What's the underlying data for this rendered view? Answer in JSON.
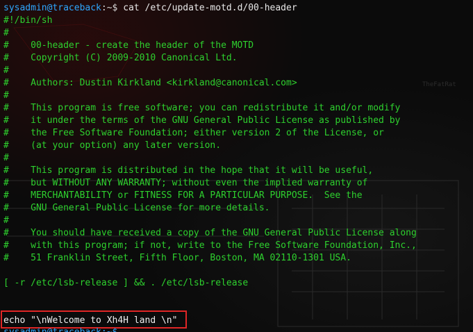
{
  "prompt": {
    "user_host": "sysadmin@traceback",
    "separator": ":~$ ",
    "command": "cat /etc/update-motd.d/00-header"
  },
  "file_lines": [
    "#!/bin/sh",
    "#",
    "#    00-header - create the header of the MOTD",
    "#    Copyright (C) 2009-2010 Canonical Ltd.",
    "#",
    "#    Authors: Dustin Kirkland <kirkland@canonical.com>",
    "#",
    "#    This program is free software; you can redistribute it and/or modify",
    "#    it under the terms of the GNU General Public License as published by",
    "#    the Free Software Foundation; either version 2 of the License, or",
    "#    (at your option) any later version.",
    "#",
    "#    This program is distributed in the hope that it will be useful,",
    "#    but WITHOUT ANY WARRANTY; without even the implied warranty of",
    "#    MERCHANTABILITY or FITNESS FOR A PARTICULAR PURPOSE.  See the",
    "#    GNU General Public License for more details.",
    "#",
    "#    You should have received a copy of the GNU General Public License along",
    "#    with this program; if not, write to the Free Software Foundation, Inc.,",
    "#    51 Franklin Street, Fifth Floor, Boston, MA 02110-1301 USA.",
    "",
    "[ -r /etc/lsb-release ] && . /etc/lsb-release",
    "",
    "",
    "echo \"\\nWelcome to Xh4H land \\n\""
  ],
  "next_prompt_partial": "sysadmin@traceback:~$",
  "colors": {
    "background": "#0b0b0b",
    "file_text": "#2ed12e",
    "prompt_user": "#2ea8ff",
    "highlight_border": "#e02626"
  }
}
